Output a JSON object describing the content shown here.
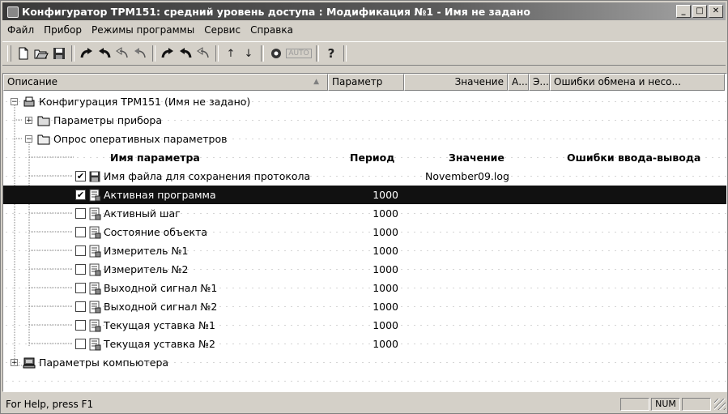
{
  "window": {
    "title": "Конфигуратор ТРМ151: средний уровень доступа : Модификация №1 - Имя не задано",
    "icon": "gear-app-icon",
    "controls": [
      "_",
      "□",
      "✕"
    ]
  },
  "menu": [
    "Файл",
    "Прибор",
    "Режимы программы",
    "Сервис",
    "Справка"
  ],
  "toolbar": {
    "icons": [
      "new-file-icon",
      "open-folder-icon",
      "save-disk-icon",
      "redo-arrow-icon",
      "undo-arrow-icon",
      "undo-all-icon",
      "undo-double-icon",
      "redo-device-icon",
      "undo-device-icon",
      "undo-device-all-icon",
      "arrow-up-icon",
      "arrow-down-icon",
      "stop-icon",
      "auto-icon",
      "help-icon"
    ],
    "auto_label": "AUTO",
    "help_glyph": "?"
  },
  "grid": {
    "columns": [
      "Описание",
      "Параметр",
      "Значение",
      "А...",
      "Э...",
      "Ошибки обмена и несо..."
    ],
    "sort_indicator": "▲",
    "root": "Конфигурация ТРМ151 (Имя не задано)",
    "device_params": "Параметры прибора",
    "polling": "Опрос оперативных параметров",
    "sub_header": {
      "name": "Имя параметра",
      "period": "Период",
      "value": "Значение",
      "errors": "Ошибки ввода-вывода"
    },
    "items": [
      {
        "name": "Имя файла для сохранения протокола",
        "checked": true,
        "icon": "floppy-disk-icon",
        "period": "",
        "value": "November09.log"
      },
      {
        "name": "Активная программа",
        "checked": true,
        "icon": "device-param-icon",
        "period": "1000",
        "value": "",
        "selected": true
      },
      {
        "name": "Активный шаг",
        "checked": false,
        "icon": "device-param-icon",
        "period": "1000",
        "value": ""
      },
      {
        "name": "Состояние объекта",
        "checked": false,
        "icon": "device-param-icon",
        "period": "1000",
        "value": ""
      },
      {
        "name": "Измеритель №1",
        "checked": false,
        "icon": "device-param-icon",
        "period": "1000",
        "value": ""
      },
      {
        "name": "Измеритель №2",
        "checked": false,
        "icon": "device-param-icon",
        "period": "1000",
        "value": ""
      },
      {
        "name": "Выходной сигнал №1",
        "checked": false,
        "icon": "device-param-icon",
        "period": "1000",
        "value": ""
      },
      {
        "name": "Выходной сигнал №2",
        "checked": false,
        "icon": "device-param-icon",
        "period": "1000",
        "value": ""
      },
      {
        "name": "Текущая уставка №1",
        "checked": false,
        "icon": "device-param-icon",
        "period": "1000",
        "value": ""
      },
      {
        "name": "Текущая уставка №2",
        "checked": false,
        "icon": "device-param-icon",
        "period": "1000",
        "value": ""
      }
    ],
    "computer_params": "Параметры компьютера"
  },
  "status": {
    "text": "For Help, press F1",
    "panels": [
      "",
      "NUM",
      ""
    ]
  },
  "colors": {
    "face": "#d4d0c8",
    "selection": "#111111",
    "title_start": "#3a3a3a",
    "title_end": "#a8a8a8"
  }
}
